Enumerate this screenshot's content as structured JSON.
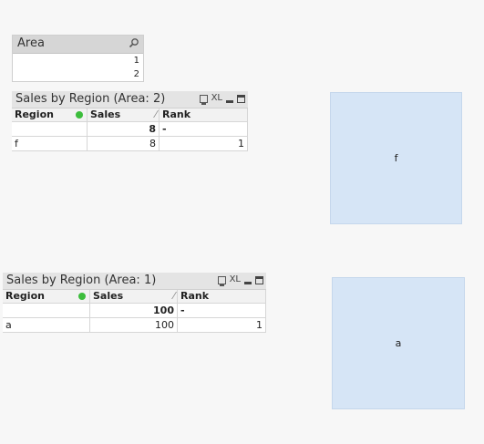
{
  "listbox": {
    "title": "Area",
    "values": [
      "1",
      "2"
    ]
  },
  "table2": {
    "title": "Sales by Region (Area: 2)",
    "xl_label": "XL",
    "headers": [
      "Region",
      "Sales",
      "Rank"
    ],
    "total": {
      "sales": "8",
      "rank": "-"
    },
    "rows": [
      {
        "region": "f",
        "sales": "8",
        "rank": "1"
      }
    ]
  },
  "table1": {
    "title": "Sales by Region (Area: 1)",
    "xl_label": "XL",
    "headers": [
      "Region",
      "Sales",
      "Rank"
    ],
    "total": {
      "sales": "100",
      "rank": "-"
    },
    "rows": [
      {
        "region": "a",
        "sales": "100",
        "rank": "1"
      }
    ]
  },
  "text_objects": {
    "top": "f",
    "bottom": "a"
  },
  "colors": {
    "text_object_bg": "#d6e5f6",
    "selected_dot": "#3cbd3c"
  }
}
